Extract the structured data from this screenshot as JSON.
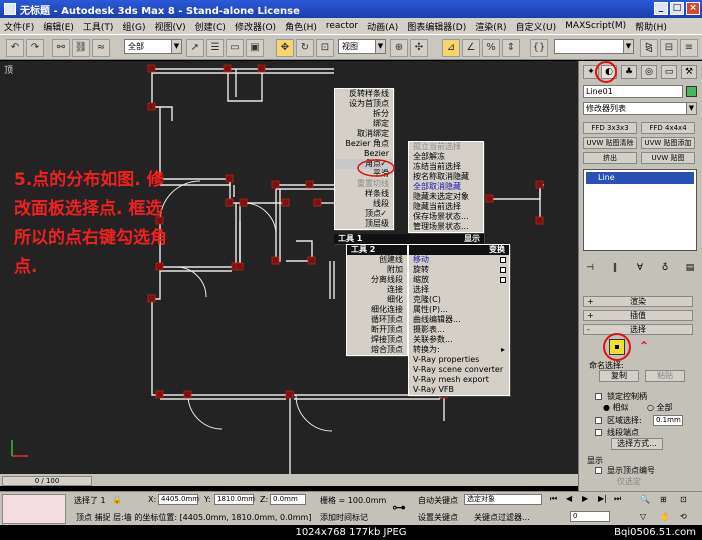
{
  "window": {
    "title": "无标题 - Autodesk 3ds Max 8 - Stand-alone License"
  },
  "menubar": [
    "文件(F)",
    "编辑(E)",
    "工具(T)",
    "组(G)",
    "视图(V)",
    "创建(C)",
    "修改器(O)",
    "角色(H)",
    "reactor",
    "动画(A)",
    "图表编辑器(D)",
    "渲染(R)",
    "自定义(U)",
    "MAXScript(M)",
    "帮助(H)"
  ],
  "toolbar": {
    "selection_filter": "全部",
    "ref_coord": "视图"
  },
  "viewport": {
    "label": "顶",
    "annotation": "5.点的分布如图. 修改面板选择点. 框选所以的点右键勾选角点."
  },
  "quad_left_top": {
    "items": [
      {
        "label": "反转样条线",
        "state": ""
      },
      {
        "label": "设为首顶点",
        "state": ""
      },
      {
        "label": "拆分",
        "state": ""
      },
      {
        "label": "绑定",
        "state": ""
      },
      {
        "label": "取消绑定",
        "state": ""
      },
      {
        "label": "Bezier 角点",
        "state": ""
      },
      {
        "label": "Bezier",
        "state": ""
      },
      {
        "label": "角点",
        "state": "checked"
      },
      {
        "label": "平滑",
        "state": ""
      },
      {
        "label": "重置切线",
        "state": "disabled"
      },
      {
        "label": "样条线",
        "state": ""
      },
      {
        "label": "线段",
        "state": ""
      },
      {
        "label": "顶点",
        "state": "checked"
      },
      {
        "label": "顶层级",
        "state": ""
      }
    ]
  },
  "quad_right_top": {
    "items": [
      {
        "label": "孤立当前选择",
        "state": "disabled"
      },
      {
        "label": "全部解冻",
        "state": ""
      },
      {
        "label": "冻结当前选择",
        "state": ""
      },
      {
        "label": "按名称取消隐藏",
        "state": ""
      },
      {
        "label": "全部取消隐藏",
        "state": "blue"
      },
      {
        "label": "隐藏未选定对象",
        "state": ""
      },
      {
        "label": "隐藏当前选择",
        "state": ""
      },
      {
        "label": "保存场景状态...",
        "state": ""
      },
      {
        "label": "管理场景状态...",
        "state": ""
      }
    ],
    "header_left": "工具 1",
    "header_right": "显示"
  },
  "quad_left_bottom": {
    "header": "工具 2",
    "items": [
      "创建线",
      "附加",
      "分离线段",
      "连接",
      "细化",
      "细化连接",
      "循环顶点",
      "断开顶点",
      "焊接顶点",
      "熔合顶点"
    ]
  },
  "quad_right_bottom": {
    "header": "变换",
    "items": [
      {
        "label": "移动",
        "state": "blue"
      },
      {
        "label": "旋转",
        "state": ""
      },
      {
        "label": "缩放",
        "state": ""
      },
      {
        "label": "选择",
        "state": ""
      },
      {
        "label": "克隆(C)",
        "state": ""
      },
      {
        "label": "属性(P)...",
        "state": ""
      },
      {
        "label": "曲线编辑器...",
        "state": ""
      },
      {
        "label": "摄影表...",
        "state": ""
      },
      {
        "label": "关联参数...",
        "state": ""
      },
      {
        "label": "转换为:",
        "state": "submenu"
      },
      {
        "label": "V-Ray properties",
        "state": ""
      },
      {
        "label": "V-Ray scene converter",
        "state": ""
      },
      {
        "label": "V-Ray mesh export",
        "state": ""
      },
      {
        "label": "V-Ray VFB",
        "state": ""
      }
    ]
  },
  "command_panel": {
    "object_name": "Line01",
    "modifier_list": "修改器列表",
    "mod_buttons": [
      "FFD 3x3x3",
      "FFD 4x4x4",
      "UVW 贴图清除",
      "UVW 贴图添加",
      "挤出",
      "UVW 贴图"
    ],
    "stack_item": "Line",
    "rollouts": [
      {
        "sign": "+",
        "label": "渲染"
      },
      {
        "sign": "+",
        "label": "插值"
      },
      {
        "sign": "-",
        "label": "选择"
      }
    ],
    "named_selection": "命名选择:",
    "copy": "复制",
    "paste": "粘贴",
    "lock_handles": "锁定控制柄",
    "alike": "相似",
    "all": "全部",
    "area_select": "区域选择:",
    "area_value": "0.1mm",
    "segment_end": "线段端点",
    "select_by": "选择方式...",
    "display": "显示",
    "show_vertex_numbers": "显示顶点编号",
    "selected_only": "仅选定"
  },
  "timeline": {
    "frame": "0 / 100"
  },
  "status": {
    "selected": "选择了 1 ",
    "x_label": "X:",
    "x_value": "4405.0mm",
    "y_label": "Y:",
    "y_value": "1810.0mm",
    "z_label": "Z:",
    "z_value": "0.0mm",
    "grid": "栅格 = 100.0mm",
    "prompt": "顶点 捕捉 层:墙 的坐标位置: [4405.0mm, 1810.0mm, 0.0mm]",
    "add_time_tag": "添加时间标记",
    "autokey": "自动关键点",
    "selected_object": "选定对象",
    "setkey": "设置关键点",
    "key_filter": "关键点过滤器...",
    "frame_field": "0"
  },
  "caption": "1024x768  177kb  JPEG",
  "watermark": "Bqi0506.51.com"
}
